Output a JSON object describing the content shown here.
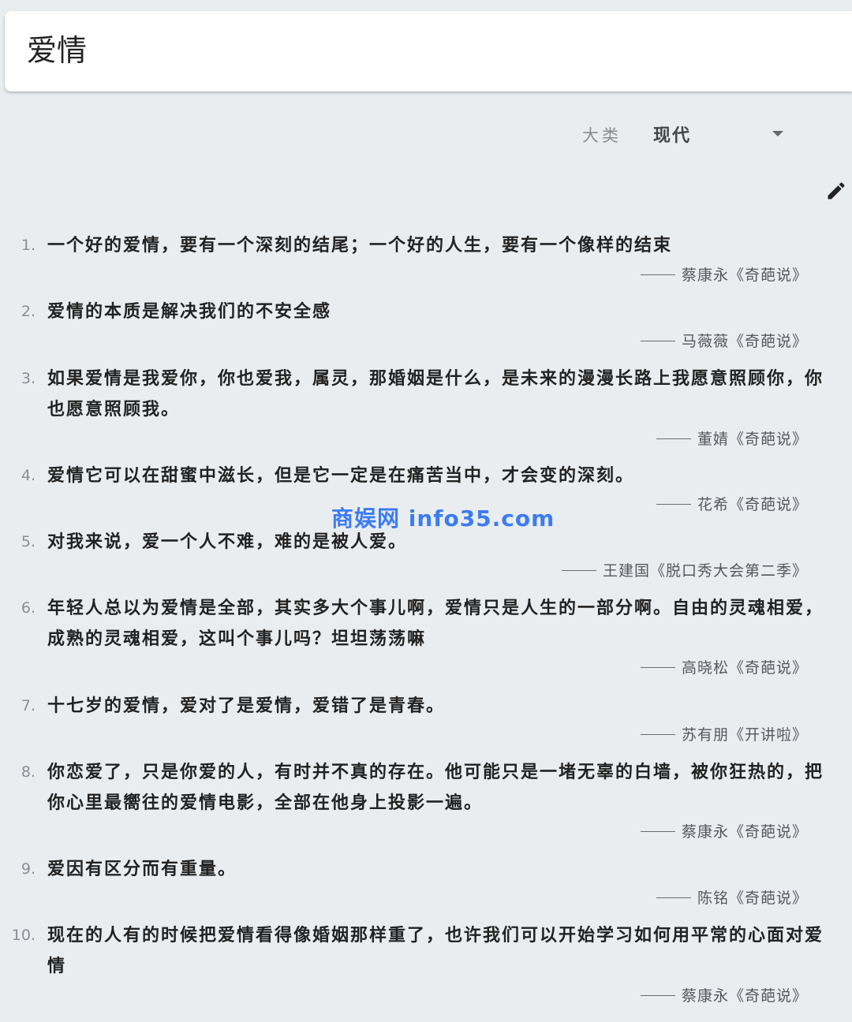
{
  "search": {
    "query": "爱情"
  },
  "filter": {
    "label": "大类",
    "value": "现代"
  },
  "icons": {
    "edit": "pencil-icon",
    "dropdown": "caret-down-icon"
  },
  "quotes": [
    {
      "num": "1.",
      "text": "一个好的爱情，要有一个深刻的结尾；一个好的人生，要有一个像样的结束",
      "source": "蔡康永《奇葩说》"
    },
    {
      "num": "2.",
      "text": "爱情的本质是解决我们的不安全感",
      "source": "马薇薇《奇葩说》"
    },
    {
      "num": "3.",
      "text": "如果爱情是我爱你，你也爱我，属灵，那婚姻是什么，是未来的漫漫长路上我愿意照顾你，你也愿意照顾我。",
      "source": "董婧《奇葩说》"
    },
    {
      "num": "4.",
      "text": "爱情它可以在甜蜜中滋长，但是它一定是在痛苦当中，才会变的深刻。",
      "source": "花希《奇葩说》"
    },
    {
      "num": "5.",
      "text": "对我来说，爱一个人不难，难的是被人爱。",
      "source": "王建国《脱口秀大会第二季》"
    },
    {
      "num": "6.",
      "text": "年轻人总以为爱情是全部，其实多大个事儿啊，爱情只是人生的一部分啊。自由的灵魂相爱，成熟的灵魂相爱，这叫个事儿吗？坦坦荡荡嘛",
      "source": "高晓松《奇葩说》"
    },
    {
      "num": "7.",
      "text": "十七岁的爱情，爱对了是爱情，爱错了是青春。",
      "source": "苏有朋《开讲啦》"
    },
    {
      "num": "8.",
      "text": "你恋爱了，只是你爱的人，有时并不真的存在。他可能只是一堵无辜的白墙，被你狂热的，把你心里最嚮往的爱情电影，全部在他身上投影一遍。",
      "source": "蔡康永《奇葩说》"
    },
    {
      "num": "9.",
      "text": "爱因有区分而有重量。",
      "source": "陈铭《奇葩说》"
    },
    {
      "num": "10.",
      "text": "现在的人有的时候把爱情看得像婚姻那样重了，也许我们可以开始学习如何用平常的心面对爱情",
      "source": "蔡康永《奇葩说》"
    }
  ],
  "watermark": "商娱网 info35.com",
  "colors": {
    "background": "#eaedf0",
    "card": "#ffffff",
    "watermark": "#3c7cf2"
  }
}
